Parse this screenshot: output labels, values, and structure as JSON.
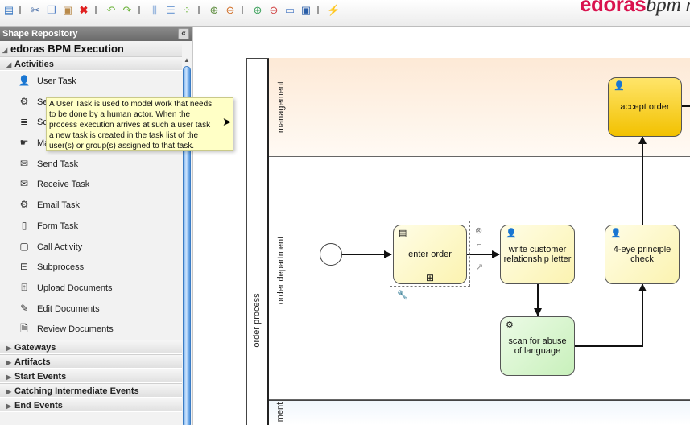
{
  "toolbar": {
    "icons": [
      "save-icon",
      "cut-icon",
      "copy-icon",
      "paste-icon",
      "delete-icon",
      "undo-icon",
      "redo-icon",
      "align-vertical-icon",
      "align-horizontal-icon",
      "group-icon",
      "add-docker-icon",
      "remove-docker-icon",
      "zoom-in-icon",
      "zoom-out-icon",
      "zoom-standard-icon",
      "zoom-fit-icon",
      "layout-icon"
    ],
    "brand_bold": "edoras",
    "brand_light": "bpm m",
    "brand_color": "#d9124e"
  },
  "sidebar": {
    "title": "Shape Repository",
    "collapse_label": "«",
    "root_label": "edoras BPM Execution",
    "open_group": "Activities",
    "items": [
      {
        "label": "User Task",
        "icon": "user-icon"
      },
      {
        "label": "Service Task",
        "icon": "gear-icon"
      },
      {
        "label": "Script Task",
        "icon": "script-icon"
      },
      {
        "label": "Manual Task",
        "icon": "hand-icon"
      },
      {
        "label": "Send Task",
        "icon": "envelope-filled-icon"
      },
      {
        "label": "Receive Task",
        "icon": "envelope-icon"
      },
      {
        "label": "Email Task",
        "icon": "gear-icon"
      },
      {
        "label": "Form Task",
        "icon": "form-icon"
      },
      {
        "label": "Call Activity",
        "icon": "call-activity-icon"
      },
      {
        "label": "Subprocess",
        "icon": "subprocess-icon"
      },
      {
        "label": "Upload Documents",
        "icon": "upload-document-icon"
      },
      {
        "label": "Edit Documents",
        "icon": "edit-document-icon"
      },
      {
        "label": "Review Documents",
        "icon": "review-document-icon"
      }
    ],
    "closed_groups": [
      "Gateways",
      "Artifacts",
      "Start Events",
      "Catching Intermediate Events",
      "End Events"
    ],
    "visible_item_labels_cut": {
      "1": "Se",
      "2": "Sc",
      "3": "Ma"
    }
  },
  "tooltip": {
    "lines": [
      "A User Task is used to model work that needs",
      "to be done by a human actor. When the",
      "process execution arrives at such a user task",
      "a new task is created in the task list of the",
      "user(s) or group(s) assigned to that task."
    ]
  },
  "diagram": {
    "pool_label": "order process",
    "lanes": [
      "management",
      "order department",
      "ment"
    ],
    "tasks": {
      "enter_order": "enter order",
      "write_letter": "write customer relationship letter",
      "four_eye": "4-eye principle check",
      "scan": "scan for abuse of language",
      "accept": "accept order"
    },
    "colors": {
      "task_yellow": "#fbf3b0",
      "task_gold": "#f2c100",
      "task_green": "#c8f0bb",
      "lane_management": "#fde9d6"
    }
  }
}
